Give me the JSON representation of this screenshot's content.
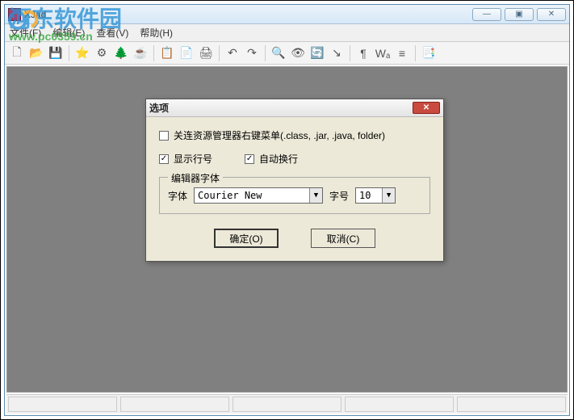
{
  "window": {
    "title": "XJad",
    "controls": {
      "min": "—",
      "max": "▣",
      "close": "✕"
    }
  },
  "menu": {
    "file": "文件(F)",
    "edit": "编辑(E)",
    "view": "查看(V)",
    "help": "帮助(H)"
  },
  "toolbar_icons": {
    "new": "🗋",
    "open": "📂",
    "save": "💾",
    "fav": "⭐",
    "settings": "⚙",
    "tree": "🌲",
    "java": "☕",
    "copy": "📋",
    "paste": "📄",
    "print": "🖨",
    "undo": "↶",
    "redo": "↷",
    "find": "🔍",
    "find2": "👁",
    "replace": "🔄",
    "goto": "↘",
    "format": "¶",
    "wrap": "Wₐ",
    "list": "≡",
    "props": "📑"
  },
  "dialog": {
    "title": "选项",
    "close": "✕",
    "assoc": {
      "checked": false,
      "label": "关连资源管理器右键菜单(.class, .jar, .java, folder)"
    },
    "show_line_no": {
      "checked": true,
      "label": "显示行号"
    },
    "auto_wrap": {
      "checked": true,
      "label": "自动换行"
    },
    "font_group": {
      "legend": "编辑器字体",
      "font_label": "字体",
      "font_value": "Courier New",
      "size_label": "字号",
      "size_value": "10"
    },
    "ok": "确定(O)",
    "cancel": "取消(C)"
  },
  "watermark": {
    "text": "河东软件园",
    "url": "www.pc0359.cn"
  }
}
